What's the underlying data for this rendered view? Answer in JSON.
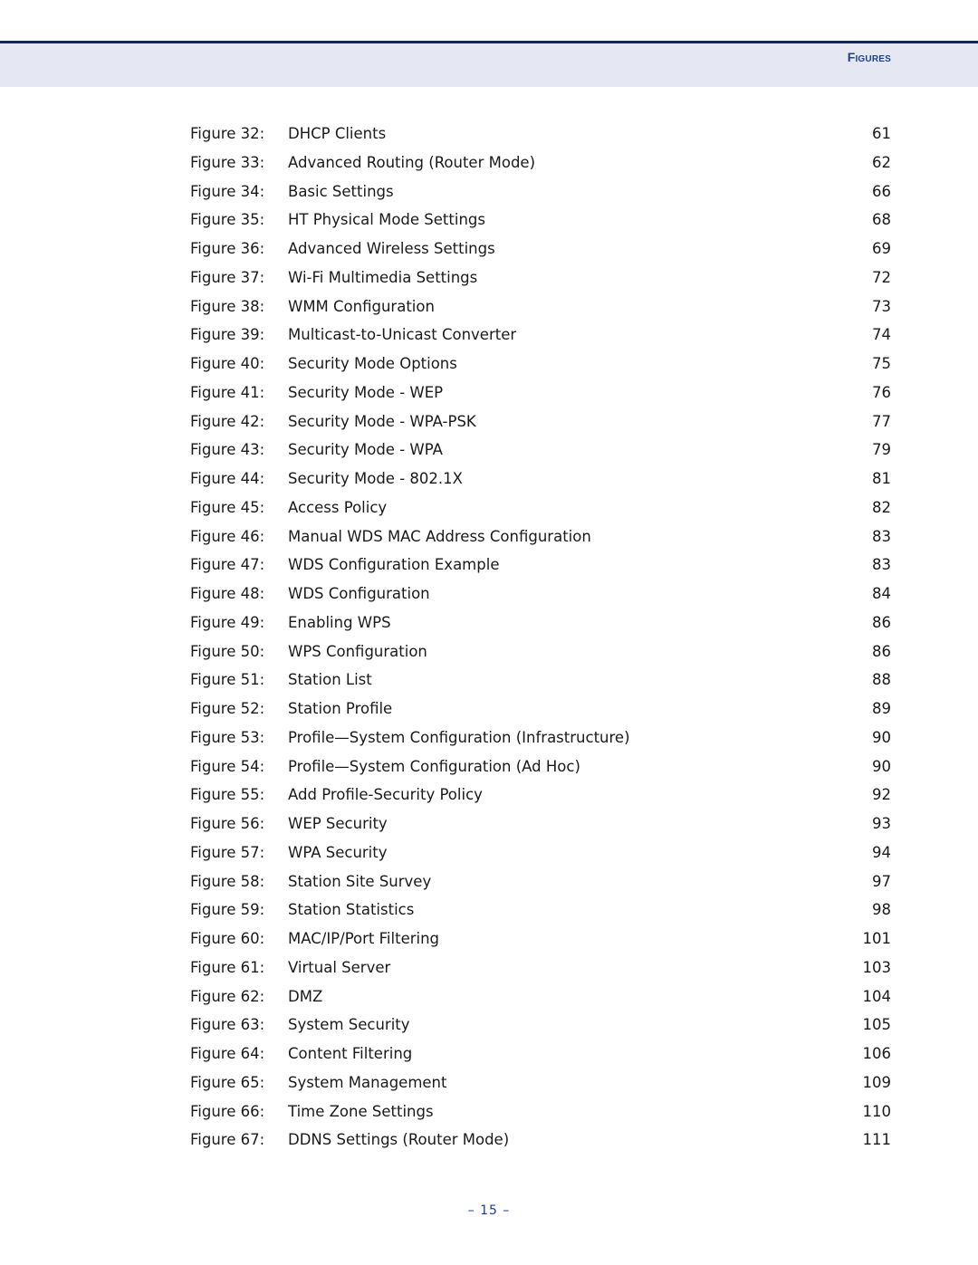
{
  "header": {
    "section_title": "Figures",
    "accent_color": "#1c3f8f",
    "band_color": "#e5e8f2",
    "rule_color": "#0d2a5c"
  },
  "figures": [
    {
      "label": "Figure 32:",
      "title": "DHCP Clients",
      "page": "61"
    },
    {
      "label": "Figure 33:",
      "title": "Advanced Routing (Router Mode)",
      "page": "62"
    },
    {
      "label": "Figure 34:",
      "title": "Basic Settings",
      "page": "66"
    },
    {
      "label": "Figure 35:",
      "title": "HT Physical Mode Settings",
      "page": "68"
    },
    {
      "label": "Figure 36:",
      "title": "Advanced Wireless Settings",
      "page": "69"
    },
    {
      "label": "Figure 37:",
      "title": "Wi-Fi Multimedia Settings",
      "page": "72"
    },
    {
      "label": "Figure 38:",
      "title": "WMM Configuration",
      "page": "73"
    },
    {
      "label": "Figure 39:",
      "title": "Multicast-to-Unicast Converter",
      "page": "74"
    },
    {
      "label": "Figure 40:",
      "title": "Security Mode Options",
      "page": "75"
    },
    {
      "label": "Figure 41:",
      "title": "Security Mode - WEP",
      "page": "76"
    },
    {
      "label": "Figure 42:",
      "title": "Security Mode - WPA-PSK",
      "page": "77"
    },
    {
      "label": "Figure 43:",
      "title": "Security Mode - WPA",
      "page": "79"
    },
    {
      "label": "Figure 44:",
      "title": "Security Mode - 802.1X",
      "page": "81"
    },
    {
      "label": "Figure 45:",
      "title": "Access Policy",
      "page": "82"
    },
    {
      "label": "Figure 46:",
      "title": "Manual WDS MAC Address Configuration",
      "page": "83"
    },
    {
      "label": "Figure 47:",
      "title": "WDS Configuration Example",
      "page": "83"
    },
    {
      "label": "Figure 48:",
      "title": "WDS Configuration",
      "page": "84"
    },
    {
      "label": "Figure 49:",
      "title": "Enabling WPS",
      "page": "86"
    },
    {
      "label": "Figure 50:",
      "title": "WPS Configuration",
      "page": "86"
    },
    {
      "label": "Figure 51:",
      "title": "Station List",
      "page": "88"
    },
    {
      "label": "Figure 52:",
      "title": "Station Profile",
      "page": "89"
    },
    {
      "label": "Figure 53:",
      "title": "Profile—System Configuration (Infrastructure)",
      "page": "90"
    },
    {
      "label": "Figure 54:",
      "title": "Profile—System Configuration (Ad Hoc)",
      "page": "90"
    },
    {
      "label": "Figure 55:",
      "title": "Add Profile-Security Policy",
      "page": "92"
    },
    {
      "label": "Figure 56:",
      "title": "WEP Security",
      "page": "93"
    },
    {
      "label": "Figure 57:",
      "title": "WPA Security",
      "page": "94"
    },
    {
      "label": "Figure 58:",
      "title": "Station Site Survey",
      "page": "97"
    },
    {
      "label": "Figure 59:",
      "title": "Station Statistics",
      "page": "98"
    },
    {
      "label": "Figure 60:",
      "title": "MAC/IP/Port Filtering",
      "page": "101"
    },
    {
      "label": "Figure 61:",
      "title": "Virtual Server",
      "page": "103"
    },
    {
      "label": "Figure 62:",
      "title": "DMZ",
      "page": "104"
    },
    {
      "label": "Figure 63:",
      "title": "System Security",
      "page": "105"
    },
    {
      "label": "Figure 64:",
      "title": "Content Filtering",
      "page": "106"
    },
    {
      "label": "Figure 65:",
      "title": "System Management",
      "page": "109"
    },
    {
      "label": "Figure 66:",
      "title": "Time Zone Settings",
      "page": "110"
    },
    {
      "label": "Figure 67:",
      "title": "DDNS Settings (Router Mode)",
      "page": "111"
    }
  ],
  "footer": {
    "page_number": "–  15  –"
  }
}
